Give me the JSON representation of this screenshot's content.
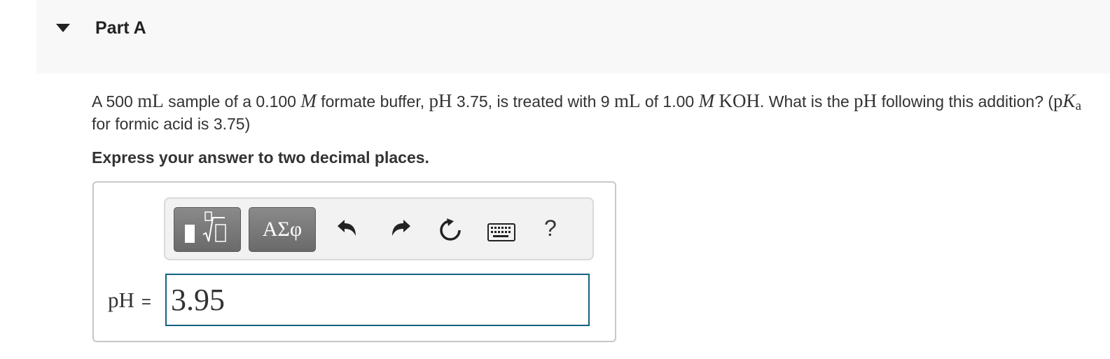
{
  "part": {
    "title": "Part A"
  },
  "question": {
    "t1": "A 500",
    "u1": "mL",
    "t2": "sample of a 0.100",
    "m1": "M",
    "t3": "formate buffer,",
    "ph1": "pH",
    "t4": "3.75, is treated with 9",
    "u2": "mL",
    "t5": "of 1.00",
    "m2": "M",
    "koh": "KOH",
    "t6": ". What is the",
    "ph2": "pH",
    "t7": "following this addition? (",
    "pk_p": "p",
    "pk_K": "K",
    "pk_a": "a",
    "t8": "for formic acid is 3.75)"
  },
  "instruction": "Express your answer to two decimal places.",
  "toolbar": {
    "greek_label": "ΑΣφ",
    "help_label": "?"
  },
  "answer": {
    "label": "pH",
    "equals": "=",
    "value": "3.95"
  },
  "colors": {
    "input_border": "#12627f",
    "toolbar_button": "#777777",
    "header_bg": "#f8f8f8"
  }
}
